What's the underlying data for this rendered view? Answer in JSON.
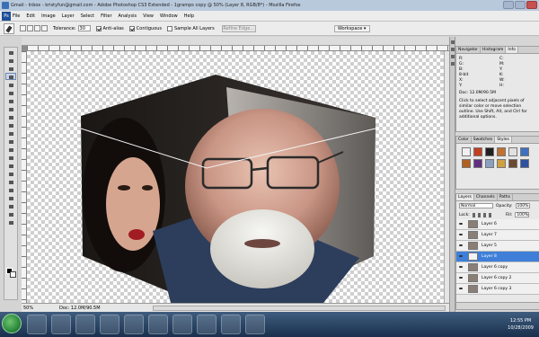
{
  "window": {
    "title": "Gmail - Inbox - kristyfun@gmail.com - Adobe Photoshop CS3 Extended - 1gramps copy @ 50% (Layer 8, RGB/8*) - Mozilla Firefox"
  },
  "menubar": {
    "logo_text": "Ps",
    "items": [
      "File",
      "Edit",
      "Image",
      "Layer",
      "Select",
      "Filter",
      "Analysis",
      "View",
      "Window",
      "Help"
    ]
  },
  "options": {
    "tolerance_label": "Tolerance:",
    "tolerance_value": "30",
    "anti_alias": "Anti-alias",
    "contiguous": "Contiguous",
    "sample_all": "Sample All Layers",
    "refine_edge": "Refine Edge...",
    "workspace": "Workspace ▾"
  },
  "status": {
    "zoom": "50%",
    "doc": "Doc: 12.0M/90.5M"
  },
  "info_panel": {
    "tabs": [
      "Navigator",
      "Histogram",
      "Info"
    ],
    "rows": [
      [
        "R:",
        "C:"
      ],
      [
        "G:",
        "M:"
      ],
      [
        "B:",
        "Y:"
      ],
      [
        "8-bit",
        "K:"
      ],
      [
        "X:",
        "W:"
      ],
      [
        "Y:",
        "H:"
      ]
    ],
    "doc": "Doc: 12.0M/90.5M",
    "note": "Click to select adjacent pixels of similar color or move selection outline. Use Shift, Alt, and Ctrl for additional options."
  },
  "styles_panel": {
    "tabs": [
      "Color",
      "Swatches",
      "Styles"
    ],
    "swatch_colors": [
      "#f0f0f0",
      "#c04020",
      "#202020",
      "#c07030",
      "#e0e0e0",
      "#4070c0",
      "#b06020",
      "#603080",
      "#8aa0c0",
      "#d0a040",
      "#6a4a30",
      "#3050a0"
    ]
  },
  "layers_panel": {
    "tabs": [
      "Layers",
      "Channels",
      "Paths"
    ],
    "blend_mode": "Normal",
    "opacity_label": "Opacity:",
    "opacity_value": "100%",
    "lock_label": "Lock:",
    "fill_label": "Fill:",
    "fill_value": "100%",
    "layers": [
      {
        "name": "Layer 6",
        "selected": false
      },
      {
        "name": "Layer 7",
        "selected": false
      },
      {
        "name": "Layer 5",
        "selected": false
      },
      {
        "name": "Layer 8",
        "selected": true
      },
      {
        "name": "Layer 6 copy",
        "selected": false
      },
      {
        "name": "Layer 6 copy 2",
        "selected": false
      },
      {
        "name": "Layer 6 copy 3",
        "selected": false
      }
    ]
  },
  "taskbar": {
    "clock_time": "12:55 PM",
    "clock_date": "10/28/2009",
    "buttons": [
      "IE",
      "Folder",
      "Ps",
      "Ae",
      "Firefox",
      "Media",
      "Paint",
      "App",
      "Mail",
      "App2"
    ]
  }
}
